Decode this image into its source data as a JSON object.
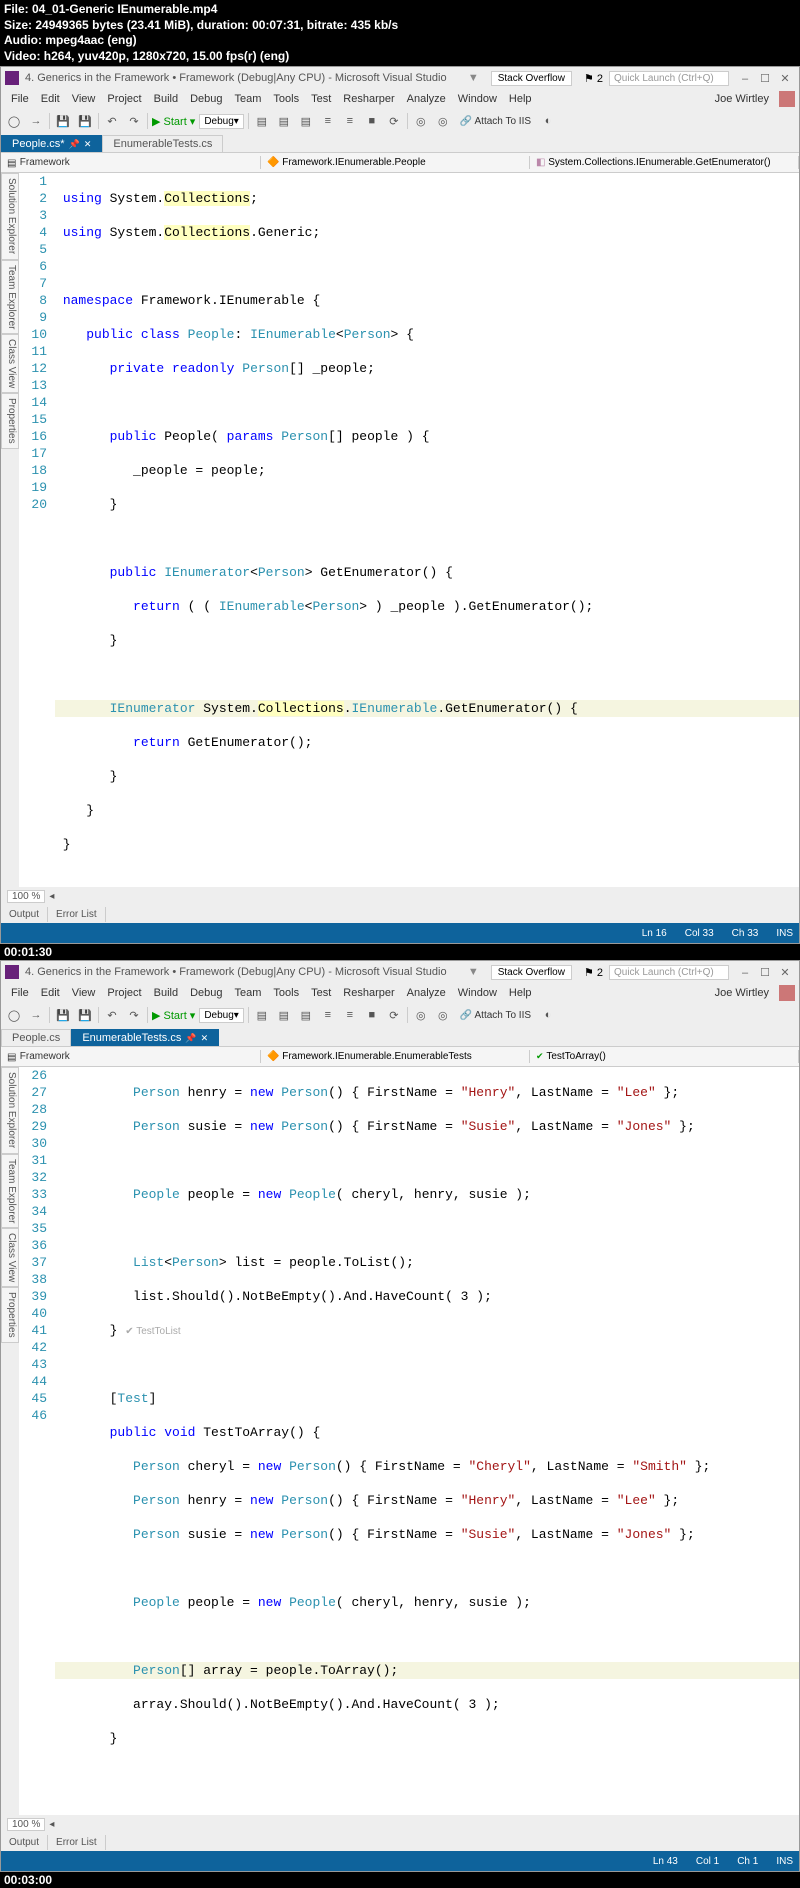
{
  "fileinfo": {
    "file": "File: 04_01-Generic IEnumerable.mp4",
    "size": "Size: 24949365 bytes (23.41 MiB), duration: 00:07:31, bitrate: 435 kb/s",
    "audio": "Audio: mpeg4aac (eng)",
    "video": "Video: h264, yuv420p, 1280x720, 15.00 fps(r) (eng)"
  },
  "timestamp1": "00:01:30",
  "timestamp2": "00:03:00",
  "vs1": {
    "title": "4. Generics in the Framework • Framework (Debug|Any CPU) - Microsoft Visual Studio",
    "menus": [
      "File",
      "Edit",
      "View",
      "Project",
      "Build",
      "Debug",
      "Team",
      "Tools",
      "Test",
      "Resharper",
      "Analyze",
      "Window",
      "Help"
    ],
    "user": "Joe Wirtley",
    "stack": "Stack Overflow",
    "badge": "2",
    "quicklaunch": "Quick Launch (Ctrl+Q)",
    "start": "Start",
    "debug": "Debug",
    "attach": "Attach To IIS",
    "tabs": [
      {
        "label": "People.cs*",
        "active": true
      },
      {
        "label": "EnumerableTests.cs",
        "active": false
      }
    ],
    "nav_fw": "Framework",
    "nav_ns": "Framework.IEnumerable.People",
    "nav_mth": "System.Collections.IEnumerable.GetEnumerator()",
    "sidetabs": [
      "Solution Explorer",
      "Team Explorer",
      "Class View",
      "Properties"
    ],
    "zoom": "100 %",
    "output_tabs": [
      "Output",
      "Error List"
    ],
    "status": {
      "ln": "Ln 16",
      "col": "Col 33",
      "ch": "Ch 33",
      "ins": "INS"
    }
  },
  "vs2": {
    "title": "4. Generics in the Framework • Framework (Debug|Any CPU) - Microsoft Visual Studio",
    "tabs": [
      {
        "label": "People.cs",
        "active": false
      },
      {
        "label": "EnumerableTests.cs",
        "active": true
      }
    ],
    "nav_fw": "Framework",
    "nav_ns": "Framework.IEnumerable.EnumerableTests",
    "nav_mth": "TestToArray()",
    "zoom": "100 %",
    "status": {
      "ln": "Ln 43",
      "col": "Col 1",
      "ch": "Ch 1",
      "ins": "INS"
    }
  }
}
